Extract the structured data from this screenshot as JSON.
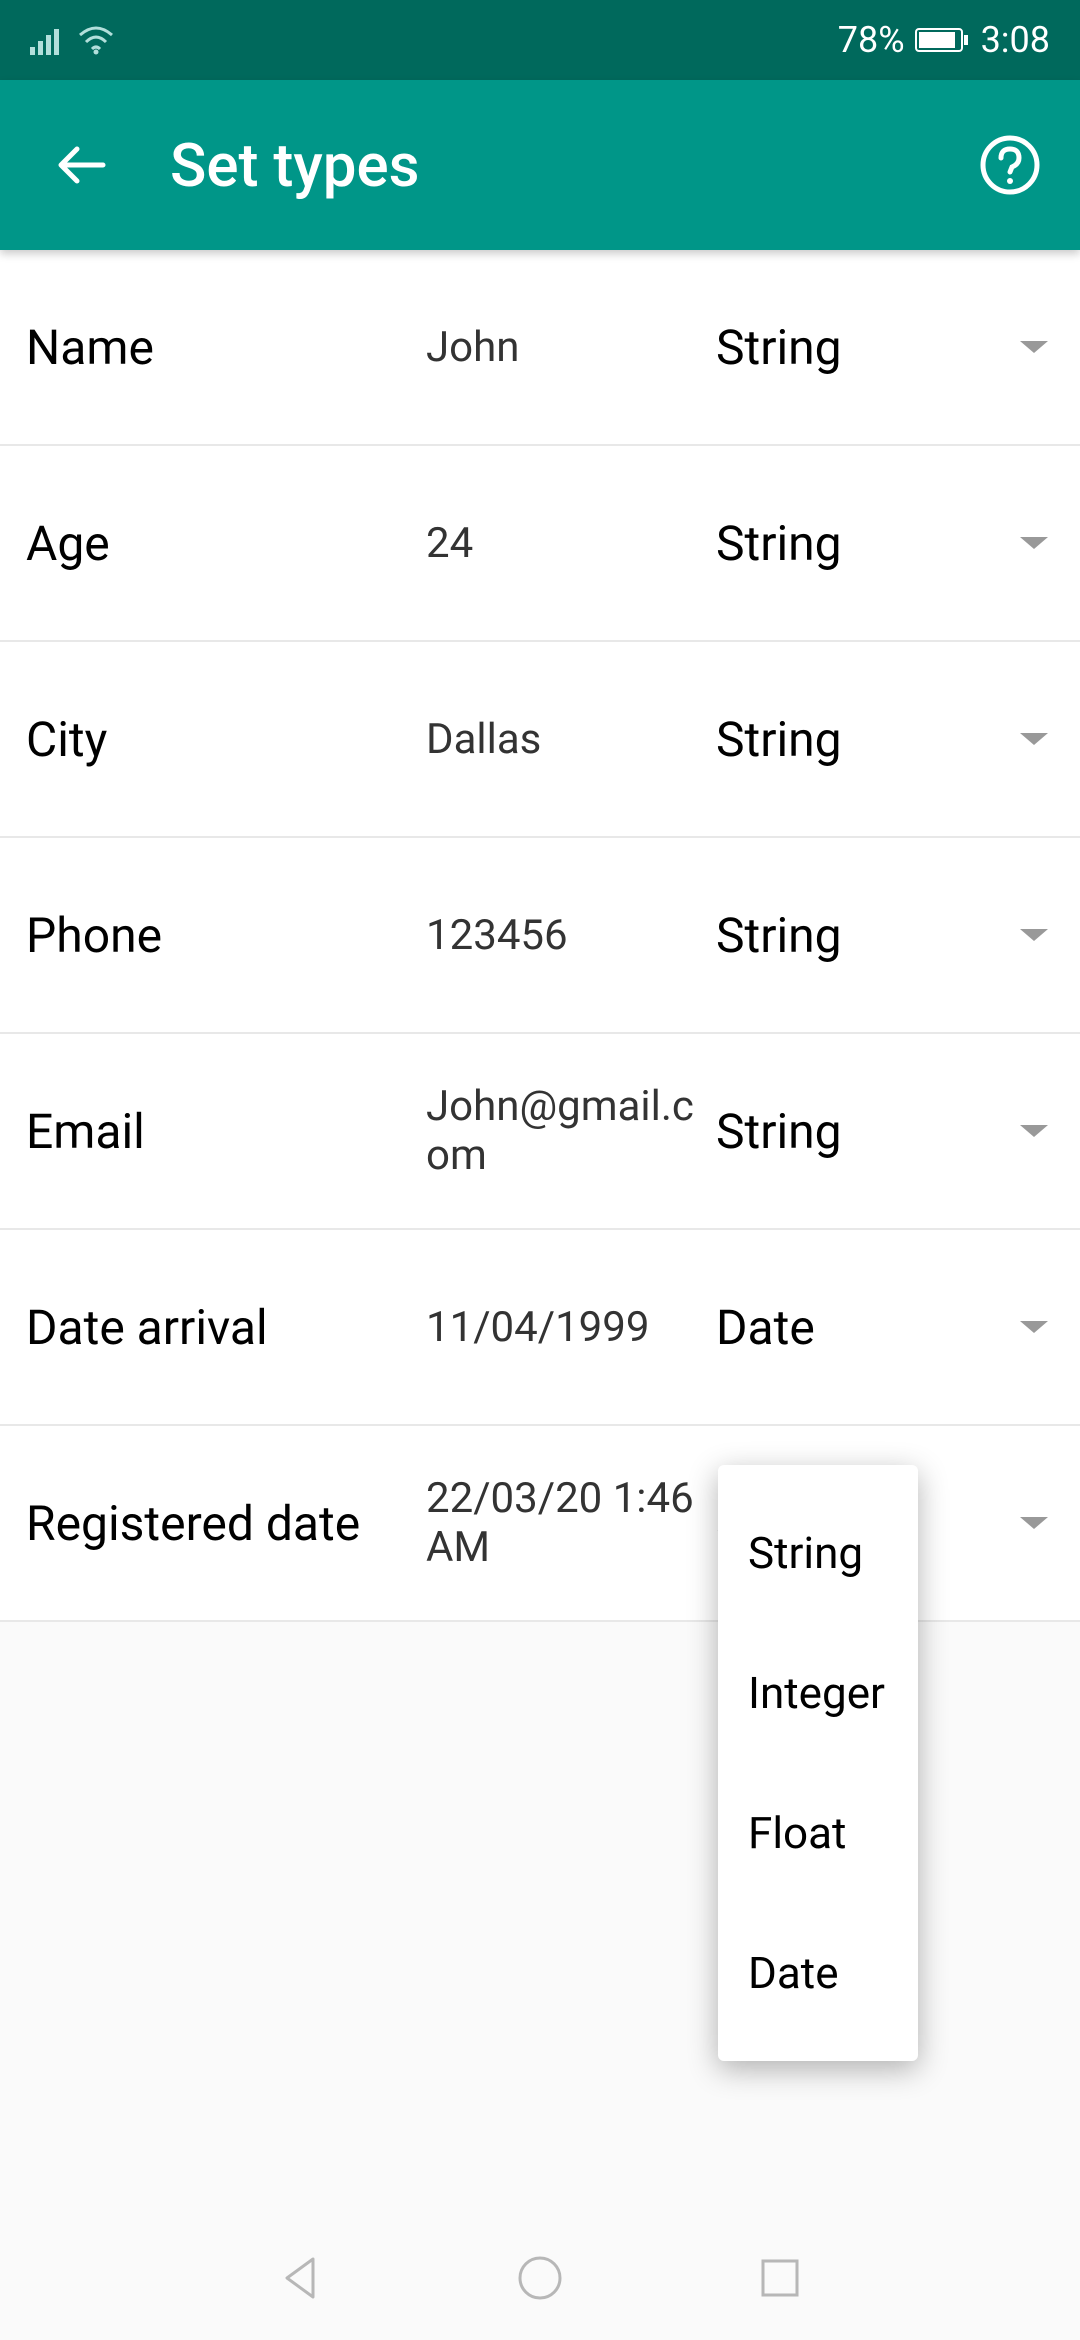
{
  "status": {
    "battery": "78%",
    "time": "3:08"
  },
  "appbar": {
    "title": "Set types"
  },
  "rows": [
    {
      "label": "Name",
      "value": "John",
      "type": "String"
    },
    {
      "label": "Age",
      "value": "24",
      "type": "String"
    },
    {
      "label": "City",
      "value": "Dallas",
      "type": "String"
    },
    {
      "label": "Phone",
      "value": "123456",
      "type": "String"
    },
    {
      "label": "Email",
      "value": "John@gmail.com",
      "type": "String"
    },
    {
      "label": "Date arrival",
      "value": "11/04/1999",
      "type": "Date"
    },
    {
      "label": "Registered date",
      "value": "22/03/20 1:46 AM",
      "type": "String"
    }
  ],
  "dropdown_options": [
    "String",
    "Integer",
    "Float",
    "Date"
  ]
}
